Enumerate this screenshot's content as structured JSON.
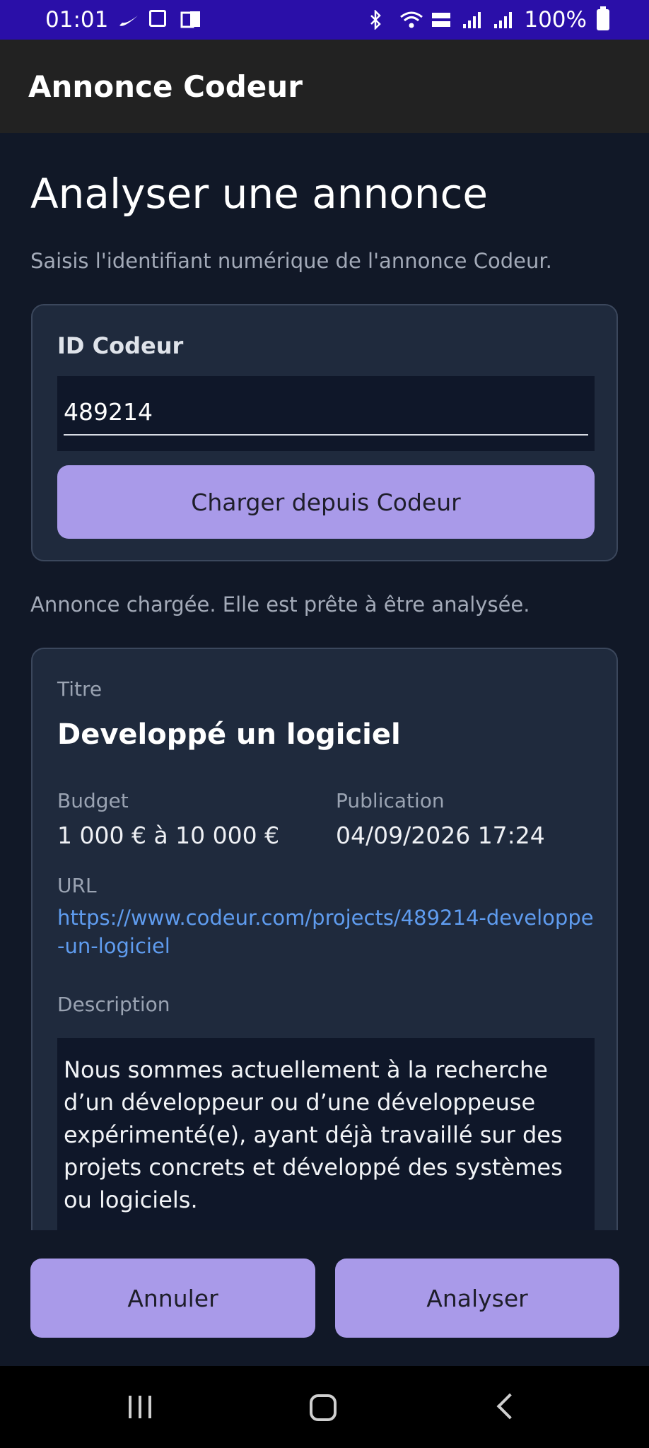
{
  "status_bar": {
    "time": "01:01",
    "battery": "100%",
    "icons_left": [
      "nike-icon",
      "image-icon",
      "document-icon"
    ],
    "icons_right": [
      "bluetooth-icon",
      "wifi-icon",
      "volte-icon",
      "signal-icon",
      "signal-icon-2",
      "battery-icon"
    ]
  },
  "app_bar": {
    "title": "Annonce Codeur"
  },
  "main": {
    "title": "Analyser une annonce",
    "subtitle": "Saisis l'identifiant numérique de l'annonce Codeur.",
    "id_card": {
      "label": "ID Codeur",
      "input_value": "489214",
      "load_button": "Charger depuis Codeur"
    },
    "status_message": "Annonce chargée. Elle est prête à être analysée.",
    "detail": {
      "title_label": "Titre",
      "title": "Developpé un logiciel",
      "budget_label": "Budget",
      "budget": "1 000 € à 10 000 €",
      "publication_label": "Publication",
      "publication": "04/09/2026 17:24",
      "url_label": "URL",
      "url": "https://www.codeur.com/projects/489214-developpe-un-logiciel",
      "description_label": "Description",
      "description": "Nous sommes actuellement à la recherche d’un développeur ou d’une développeuse expérimenté(e), ayant déjà travaillé sur des projets concrets et développé des systèmes ou logiciels."
    }
  },
  "actions": {
    "cancel": "Annuler",
    "analyze": "Analyser"
  },
  "colors": {
    "background": "#111827",
    "card": "#1f2a3d",
    "accent_button": "#a99ae9",
    "link": "#5f9cef",
    "status_bar": "#2a0fa8"
  }
}
